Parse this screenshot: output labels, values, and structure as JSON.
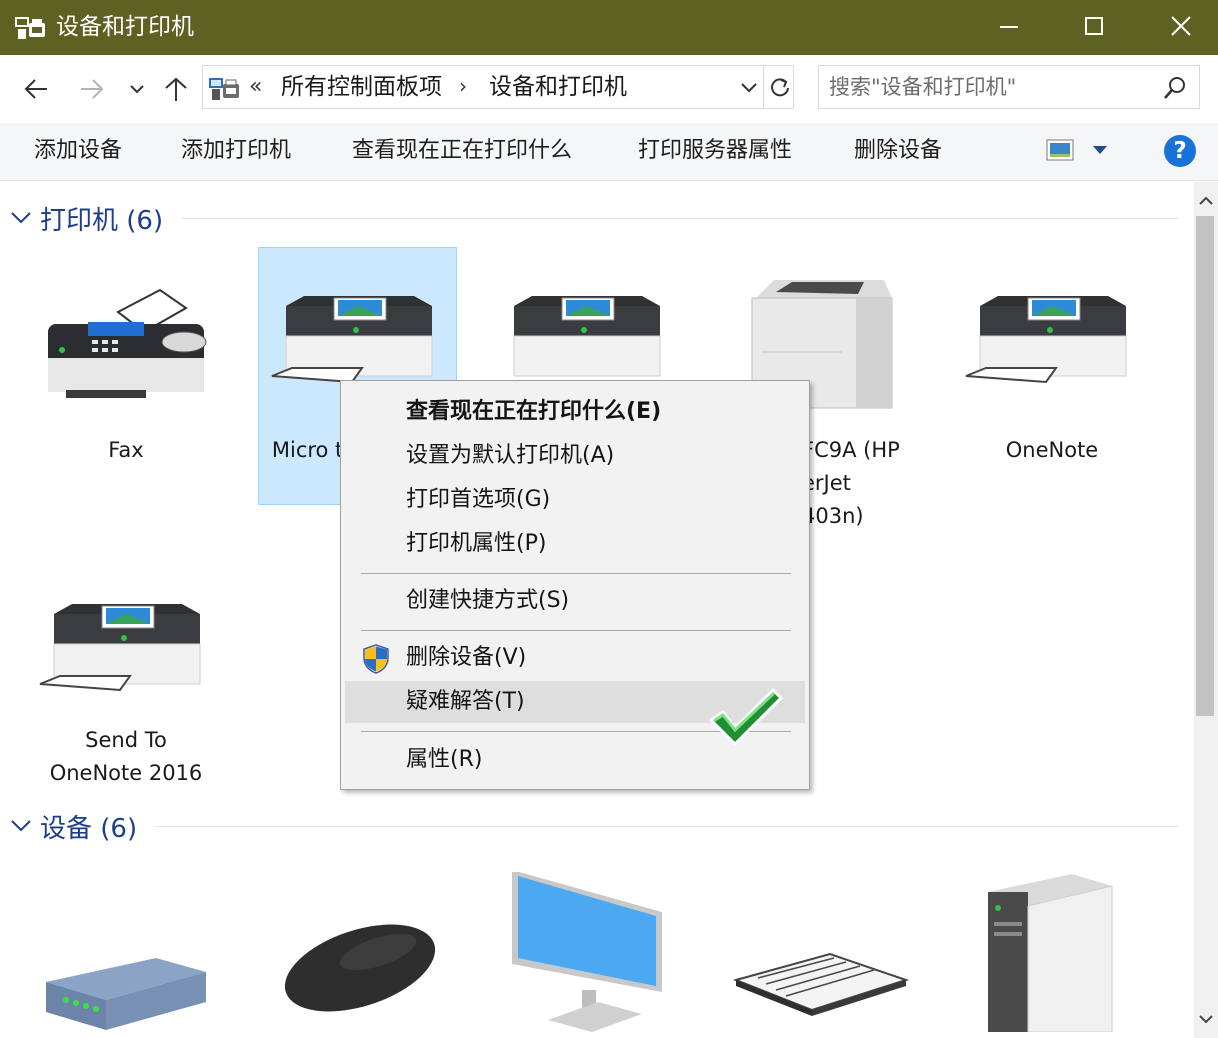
{
  "window": {
    "title": "设备和打印机"
  },
  "nav": {
    "breadcrumb_prefix": "«",
    "breadcrumb": [
      "所有控制面板项",
      "设备和打印机"
    ],
    "breadcrumb_separator": "›",
    "search_placeholder": "搜索\"设备和打印机\""
  },
  "toolbar": {
    "commands": [
      "添加设备",
      "添加打印机",
      "查看现在正在打印什么",
      "打印服务器属性",
      "删除设备"
    ],
    "help_label": "?"
  },
  "printers": {
    "header": "打印机 (6)",
    "items": [
      {
        "label": "Fax",
        "icon": "fax-icon"
      },
      {
        "label_visible": "Micro\nto",
        "icon": "printer-icon",
        "selected": true
      },
      {
        "label": "",
        "icon": "printer-icon"
      },
      {
        "label_visible": "FC9A (HP\nerJet\n403n)",
        "icon": "laser-printer-icon"
      },
      {
        "label": "OneNote",
        "icon": "printer-icon"
      },
      {
        "label": "Send To\nOneNote 2016",
        "icon": "printer-icon"
      }
    ]
  },
  "devices": {
    "header": "设备 (6)",
    "items": [
      {
        "icon": "modem-icon"
      },
      {
        "icon": "mouse-icon"
      },
      {
        "icon": "monitor-icon"
      },
      {
        "icon": "keyboard-icon"
      },
      {
        "icon": "computer-tower-icon"
      }
    ]
  },
  "context_menu": {
    "items": [
      {
        "label": "查看现在正在打印什么(E)",
        "bold": true
      },
      {
        "label": "设置为默认打印机(A)"
      },
      {
        "label": "打印首选项(G)"
      },
      {
        "label": "打印机属性(P)"
      },
      {
        "label": "创建快捷方式(S)"
      },
      {
        "label": "删除设备(V)",
        "icon": "uac-shield-icon"
      },
      {
        "label": "疑难解答(T)",
        "highlighted": true,
        "annotation": "green-checkmark-icon"
      },
      {
        "label": "属性(R)"
      }
    ]
  },
  "colors": {
    "titlebar": "#5d6122",
    "group_header": "#1d3e8a",
    "selection": "#cce8ff",
    "help": "#1773d9",
    "checkmark": "#22a83a"
  }
}
